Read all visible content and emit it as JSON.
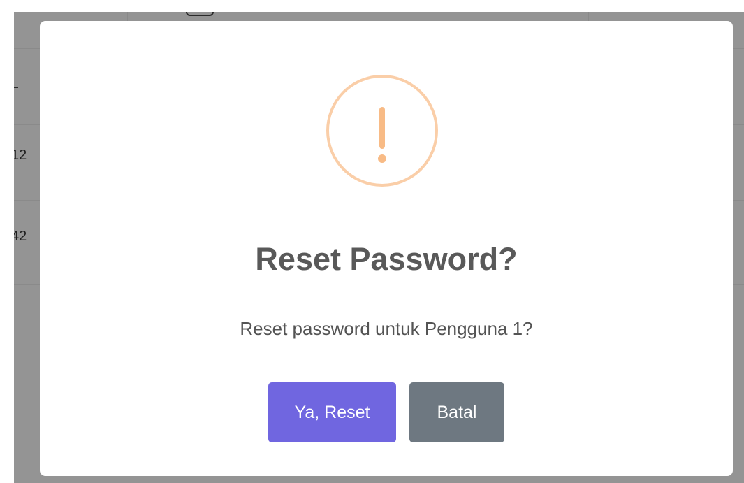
{
  "background": {
    "row_values": [
      "12",
      "42"
    ]
  },
  "dialog": {
    "title": "Reset Password?",
    "message": "Reset password untuk Pengguna 1?",
    "icon": "warning-exclamation-icon",
    "confirm_label": "Ya, Reset",
    "cancel_label": "Batal"
  },
  "colors": {
    "confirm_button": "#7066e0",
    "cancel_button": "#6e7881",
    "warning_ring": "#facea8",
    "warning_mark": "#f8bb86",
    "backdrop": "#949494"
  }
}
